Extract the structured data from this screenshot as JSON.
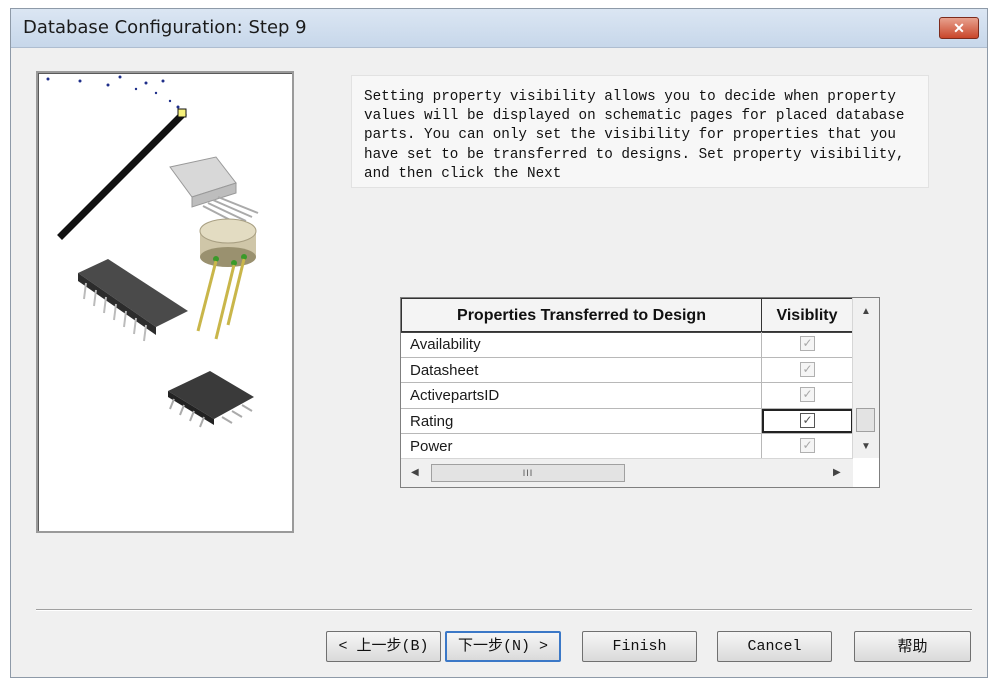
{
  "window": {
    "title": "Database Configuration: Step 9",
    "close_label": "✕"
  },
  "description": "Setting property visibility allows you to decide when property values will be displayed on schematic pages for placed database parts. You can only set the visibility for properties that you have set to be transferred to designs. Set property visibility, and then click the Next",
  "grid": {
    "headers": {
      "property": "Properties Transferred to Design",
      "visibility": "Visiblity"
    },
    "rows": [
      {
        "name": "Availability",
        "checked": true,
        "selected": false
      },
      {
        "name": "Datasheet",
        "checked": true,
        "selected": false
      },
      {
        "name": "ActivepartsID",
        "checked": true,
        "selected": false
      },
      {
        "name": "Rating",
        "checked": true,
        "selected": true
      },
      {
        "name": "Power",
        "checked": true,
        "selected": false
      }
    ],
    "check_glyph": "✓",
    "scroll_up": "▲",
    "scroll_down": "▼",
    "scroll_left": "◀",
    "scroll_right": "▶",
    "h_thumb_grip": "III"
  },
  "buttons": {
    "back": "< 上一步(B)",
    "next": "下一步(N) >",
    "finish": "Finish",
    "cancel": "Cancel",
    "help": "帮助"
  },
  "colors": {
    "title_bar": "#c7d7ea",
    "close_button": "#c9462b",
    "focus_border": "#3b78c7"
  }
}
